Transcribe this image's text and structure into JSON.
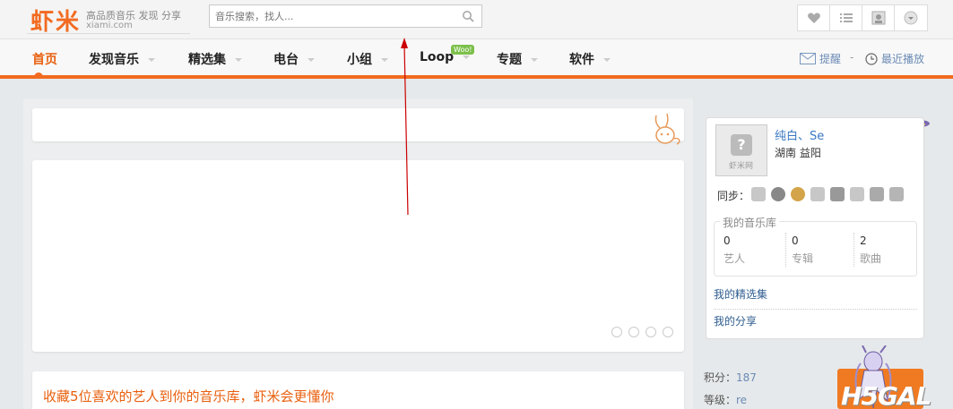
{
  "header": {
    "logo_mark": "虾米",
    "logo_tagline": "高品质音乐 发现 分享",
    "logo_domain": "xiami.com",
    "search_placeholder": "音乐搜索，找人...",
    "tools": [
      "heart-icon",
      "list-icon",
      "avatar-icon",
      "dropdown-icon"
    ]
  },
  "nav": {
    "items": [
      {
        "label": "首页",
        "active": true
      },
      {
        "label": "发现音乐"
      },
      {
        "label": "精选集"
      },
      {
        "label": "电台"
      },
      {
        "label": "小组"
      },
      {
        "label": "Loop",
        "badge": "Woo!"
      },
      {
        "label": "专题"
      },
      {
        "label": "软件"
      }
    ],
    "reminder": "提醒",
    "recent_play": "最近播放"
  },
  "main": {
    "headline": "收藏5位喜欢的艺人到你的音乐库，虾米会更懂你",
    "carousel_dots": 4
  },
  "profile": {
    "avatar_text": "虾米网",
    "avatar_mark": "?",
    "name": "纯白、Se",
    "location": "湖南 益阳",
    "sync_label": "同步：",
    "sync_icons": 8,
    "library_title": "我的音乐库",
    "library": [
      {
        "num": "0",
        "label": "艺人"
      },
      {
        "num": "0",
        "label": "专辑"
      },
      {
        "num": "2",
        "label": "歌曲"
      }
    ],
    "my_collections": "我的精选集",
    "my_shares": "我的分享"
  },
  "stats": {
    "points_label": "积分：",
    "points_value": "187",
    "level_label": "等级：",
    "level_value": "re"
  },
  "watermark": "H5GAL",
  "colors": {
    "brand": "#f26b21",
    "link": "#3a78c3",
    "annotation": "#cc0000"
  }
}
